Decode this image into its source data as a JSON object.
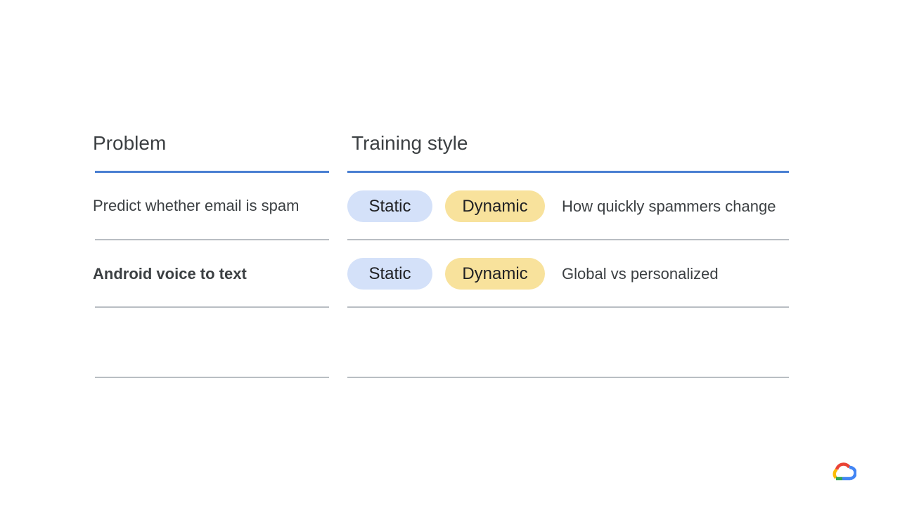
{
  "headers": {
    "problem": "Problem",
    "training_style": "Training style"
  },
  "rows": [
    {
      "problem": "Predict whether email is spam",
      "options": [
        "Static",
        "Dynamic"
      ],
      "note": "How quickly spammers change"
    },
    {
      "problem": "Android voice to text",
      "options": [
        "Static",
        "Dynamic"
      ],
      "note": "Global vs personalized"
    },
    {
      "problem": "",
      "options": [],
      "note": ""
    }
  ],
  "colors": {
    "header_rule": "#4a7fd2",
    "row_rule": "#b9bec3",
    "static_chip": "#d4e1f9",
    "dynamic_chip": "#f8e29c"
  },
  "logo": {
    "icon": "google-cloud-logo-icon"
  }
}
